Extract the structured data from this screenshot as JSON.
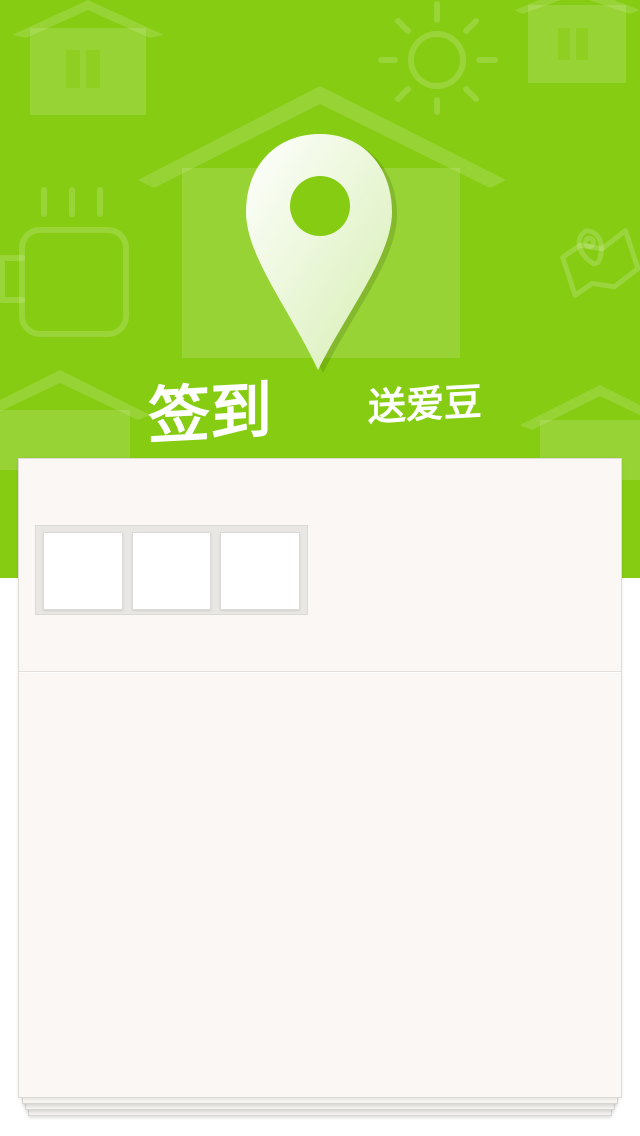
{
  "hero": {
    "background_color": "#86cc13",
    "decor_icons": [
      "house-icon",
      "sun-icon",
      "coffee-cup-icon",
      "map-pin-icon",
      "map-icon"
    ],
    "title_main": "签到",
    "title_sub": "送爱豆"
  },
  "checkin_card": {
    "slots": [
      {
        "icon": "",
        "checked": false
      },
      {
        "icon": "",
        "checked": false
      },
      {
        "icon": "",
        "checked": false
      }
    ]
  }
}
